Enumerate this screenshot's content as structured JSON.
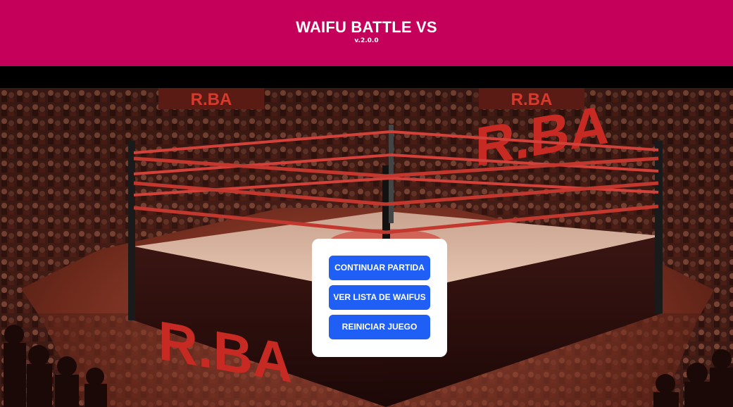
{
  "header": {
    "title": "WAIFU BATTLE VS",
    "version": "v.2.0.0",
    "background_color": "#c4005b"
  },
  "arena": {
    "banner_text": "R.BA",
    "apron_text": "R.BA"
  },
  "menu": {
    "buttons": [
      {
        "label": "CONTINUAR PARTIDA"
      },
      {
        "label": "VER LISTA DE WAIFUS"
      },
      {
        "label": "REINICIAR JUEGO"
      }
    ],
    "button_color": "#1f5ff5"
  }
}
